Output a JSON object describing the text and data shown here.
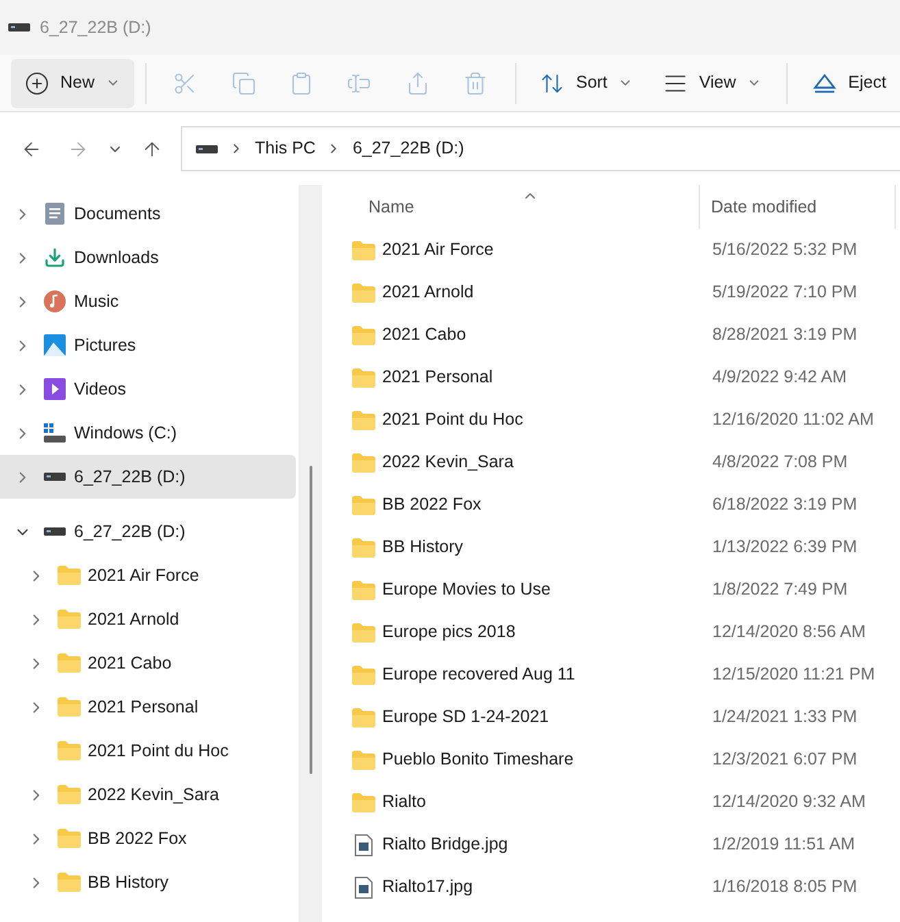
{
  "window": {
    "title": "6_27_22B (D:)"
  },
  "toolbar": [
    {
      "kind": "new",
      "label": "New",
      "dropdown": true,
      "disabled": false
    },
    {
      "kind": "cut",
      "disabled": true
    },
    {
      "kind": "copy",
      "disabled": true
    },
    {
      "kind": "paste",
      "disabled": true
    },
    {
      "kind": "rename",
      "disabled": true
    },
    {
      "kind": "share",
      "disabled": true
    },
    {
      "kind": "delete",
      "disabled": true
    },
    {
      "kind": "sort",
      "label": "Sort",
      "dropdown": true,
      "disabled": false
    },
    {
      "kind": "view",
      "label": "View",
      "dropdown": true,
      "disabled": false
    },
    {
      "kind": "eject",
      "label": "Eject",
      "dropdown": false,
      "disabled": false
    }
  ],
  "navigation": {
    "back_disabled": false,
    "forward_disabled": true
  },
  "address_bar": {
    "crumbs": [
      "This PC",
      "6_27_22B (D:)"
    ]
  },
  "sidebar": {
    "items": [
      {
        "kind": "documents",
        "label": "Documents",
        "expandable": true,
        "expanded": false,
        "selected": false
      },
      {
        "kind": "downloads",
        "label": "Downloads",
        "expandable": true,
        "expanded": false,
        "selected": false
      },
      {
        "kind": "music",
        "label": "Music",
        "expandable": true,
        "expanded": false,
        "selected": false
      },
      {
        "kind": "pictures",
        "label": "Pictures",
        "expandable": true,
        "expanded": false,
        "selected": false
      },
      {
        "kind": "videos",
        "label": "Videos",
        "expandable": true,
        "expanded": false,
        "selected": false
      },
      {
        "kind": "windows-drive",
        "label": "Windows (C:)",
        "expandable": true,
        "expanded": false,
        "selected": false
      },
      {
        "kind": "drive",
        "label": "6_27_22B (D:)",
        "expandable": true,
        "expanded": false,
        "selected": true
      },
      {
        "kind": "drive",
        "label": "6_27_22B (D:)",
        "expandable": true,
        "expanded": true,
        "selected": false,
        "children": [
          {
            "kind": "folder",
            "label": "2021 Air Force",
            "expandable": true,
            "expanded": false,
            "selected": false
          },
          {
            "kind": "folder",
            "label": "2021 Arnold",
            "expandable": true,
            "expanded": false,
            "selected": false
          },
          {
            "kind": "folder",
            "label": "2021 Cabo",
            "expandable": true,
            "expanded": false,
            "selected": false
          },
          {
            "kind": "folder",
            "label": "2021 Personal",
            "expandable": true,
            "expanded": false,
            "selected": false
          },
          {
            "kind": "folder",
            "label": "2021 Point du Hoc",
            "expandable": false,
            "expanded": false,
            "selected": false
          },
          {
            "kind": "folder",
            "label": "2022 Kevin_Sara",
            "expandable": true,
            "expanded": false,
            "selected": false
          },
          {
            "kind": "folder",
            "label": "BB 2022 Fox",
            "expandable": true,
            "expanded": false,
            "selected": false
          },
          {
            "kind": "folder",
            "label": "BB History",
            "expandable": true,
            "expanded": false,
            "selected": false
          }
        ]
      }
    ]
  },
  "table": {
    "columns": [
      "Name",
      "Date modified"
    ],
    "rows": [
      {
        "kind": "folder",
        "name": "2021 Air Force",
        "date": "5/16/2022 5:32 PM"
      },
      {
        "kind": "folder",
        "name": "2021 Arnold",
        "date": "5/19/2022 7:10 PM"
      },
      {
        "kind": "folder",
        "name": "2021 Cabo",
        "date": "8/28/2021 3:19 PM"
      },
      {
        "kind": "folder",
        "name": "2021 Personal",
        "date": "4/9/2022 9:42 AM"
      },
      {
        "kind": "folder",
        "name": "2021 Point du Hoc",
        "date": "12/16/2020 11:02 AM"
      },
      {
        "kind": "folder",
        "name": "2022 Kevin_Sara",
        "date": "4/8/2022 7:08 PM"
      },
      {
        "kind": "folder",
        "name": "BB 2022 Fox",
        "date": "6/18/2022 3:19 PM"
      },
      {
        "kind": "folder",
        "name": "BB History",
        "date": "1/13/2022 6:39 PM"
      },
      {
        "kind": "folder",
        "name": "Europe Movies to Use",
        "date": "1/8/2022 7:49 PM"
      },
      {
        "kind": "folder",
        "name": "Europe pics 2018",
        "date": "12/14/2020 8:56 AM"
      },
      {
        "kind": "folder",
        "name": "Europe recovered Aug 11",
        "date": "12/15/2020 11:21 PM"
      },
      {
        "kind": "folder",
        "name": "Europe SD 1-24-2021",
        "date": "1/24/2021 1:33 PM"
      },
      {
        "kind": "folder",
        "name": "Pueblo Bonito Timeshare",
        "date": "12/3/2021 6:07 PM"
      },
      {
        "kind": "folder",
        "name": "Rialto",
        "date": "12/14/2020 9:32 AM"
      },
      {
        "kind": "image",
        "name": "Rialto Bridge.jpg",
        "date": "1/2/2019 11:51 AM"
      },
      {
        "kind": "image",
        "name": "Rialto17.jpg",
        "date": "1/16/2018 8:05 PM"
      }
    ]
  }
}
